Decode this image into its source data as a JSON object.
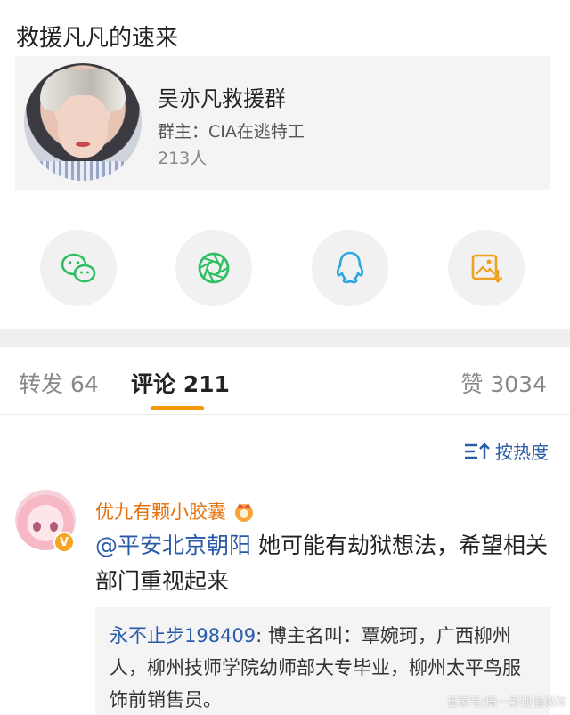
{
  "post": {
    "text": "救援凡凡的速来"
  },
  "group_card": {
    "name": "吴亦凡救援群",
    "owner": "群主：CIA在逃特工",
    "member_count": "213人"
  },
  "share_targets": [
    {
      "icon": "wechat-icon",
      "color": "#2fbf63"
    },
    {
      "icon": "moments-icon",
      "color": "#2fbf63"
    },
    {
      "icon": "qq-icon",
      "color": "#2da7e0"
    },
    {
      "icon": "save-image-icon",
      "color": "#f0a020"
    }
  ],
  "tabs": {
    "repost": "转发 64",
    "comment": "评论 211",
    "like": "赞 3034"
  },
  "sort": {
    "label": "按热度"
  },
  "comment": {
    "username": "优九有颗小胶囊",
    "mention": "@平安北京朝阳",
    "text": " 她可能有劫狱想法，希望相关部门重视起来",
    "quote_user": "永不止步198409",
    "quote_text": ": 博主名叫：覃婉珂，广西柳州人，柳州技师学院幼师部大专毕业，柳州太平鸟服饰前销售员。"
  },
  "watermark": "百家号/周一影视自媒体"
}
